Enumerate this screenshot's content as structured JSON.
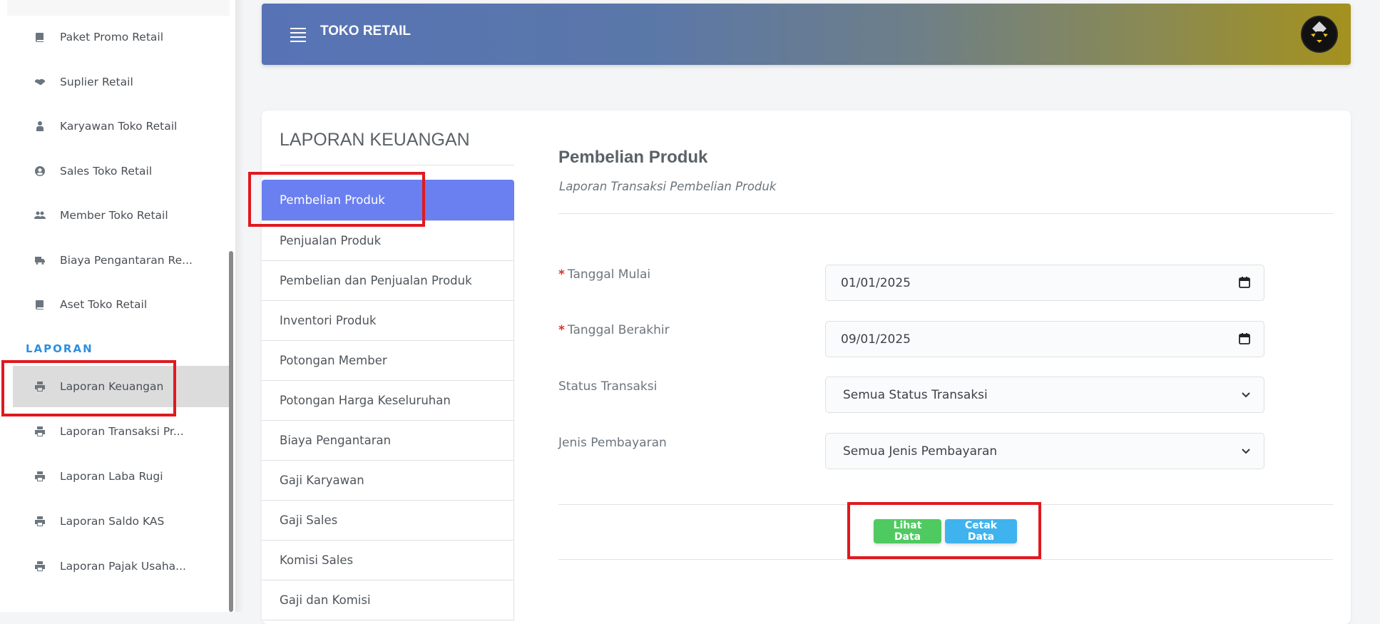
{
  "sidebar": {
    "items": [
      {
        "label": "Paket Promo Retail",
        "icon": "book-icon"
      },
      {
        "label": "Suplier Retail",
        "icon": "handshake-icon"
      },
      {
        "label": "Karyawan Toko Retail",
        "icon": "user-tie-icon"
      },
      {
        "label": "Sales Toko Retail",
        "icon": "user-circle-icon"
      },
      {
        "label": "Member Toko Retail",
        "icon": "users-icon"
      },
      {
        "label": "Biaya Pengantaran Re...",
        "icon": "truck-icon"
      },
      {
        "label": "Aset Toko Retail",
        "icon": "book-icon"
      }
    ],
    "section_label": "LAPORAN",
    "report_items": [
      {
        "label": "Laporan Keuangan",
        "icon": "printer-icon",
        "active": true
      },
      {
        "label": "Laporan Transaksi Pr...",
        "icon": "printer-icon"
      },
      {
        "label": "Laporan Laba Rugi",
        "icon": "printer-icon"
      },
      {
        "label": "Laporan Saldo KAS",
        "icon": "printer-icon"
      },
      {
        "label": "Laporan Pajak Usaha...",
        "icon": "printer-icon"
      }
    ]
  },
  "header": {
    "title": "TOKO RETAIL"
  },
  "card": {
    "title": "LAPORAN KEUANGAN",
    "reports": [
      "Pembelian Produk",
      "Penjualan Produk",
      "Pembelian dan Penjualan Produk",
      "Inventori Produk",
      "Potongan Member",
      "Potongan Harga Keseluruhan",
      "Biaya Pengantaran",
      "Gaji Karyawan",
      "Gaji Sales",
      "Komisi Sales",
      "Gaji dan Komisi"
    ],
    "active_report": "Pembelian Produk"
  },
  "form": {
    "title": "Pembelian Produk",
    "subtitle": "Laporan Transaksi Pembelian Produk",
    "required_mark": "*",
    "start_date_label": "Tanggal Mulai",
    "start_date_value": "01/01/2025",
    "end_date_label": "Tanggal Berakhir",
    "end_date_value": "09/01/2025",
    "status_label": "Status Transaksi",
    "status_value": "Semua Status Transaksi",
    "payment_label": "Jenis Pembayaran",
    "payment_value": "Semua Jenis Pembayaran",
    "view_button": "Lihat Data",
    "print_button": "Cetak Data"
  },
  "colors": {
    "accent": "#6a7ff0",
    "section": "#2d8fe0",
    "highlight": "#e0191f",
    "green": "#4fca60",
    "blue": "#3fb3ee"
  }
}
